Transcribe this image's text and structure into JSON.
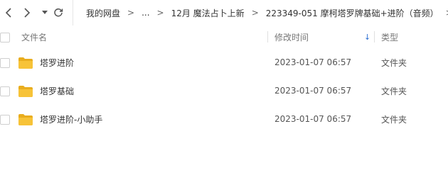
{
  "nav": {
    "breadcrumbs": [
      "我的网盘",
      "...",
      "12月 魔法占卜上新",
      "223349-051 摩柯塔罗牌基础+进阶（音频）"
    ],
    "separator": ">"
  },
  "header": {
    "name": "文件名",
    "time": "修改时间",
    "sort": "↓",
    "type": "类型"
  },
  "files": [
    {
      "name": "塔罗进阶",
      "time": "2023-01-07 06:57",
      "type": "文件夹"
    },
    {
      "name": "塔罗基础",
      "time": "2023-01-07 06:57",
      "type": "文件夹"
    },
    {
      "name": "塔罗进阶-小助手",
      "time": "2023-01-07 06:57",
      "type": "文件夹"
    }
  ],
  "colors": {
    "folder": "#f7c338",
    "folder_dark": "#e9ad1e",
    "accent": "#2d6fd2"
  }
}
